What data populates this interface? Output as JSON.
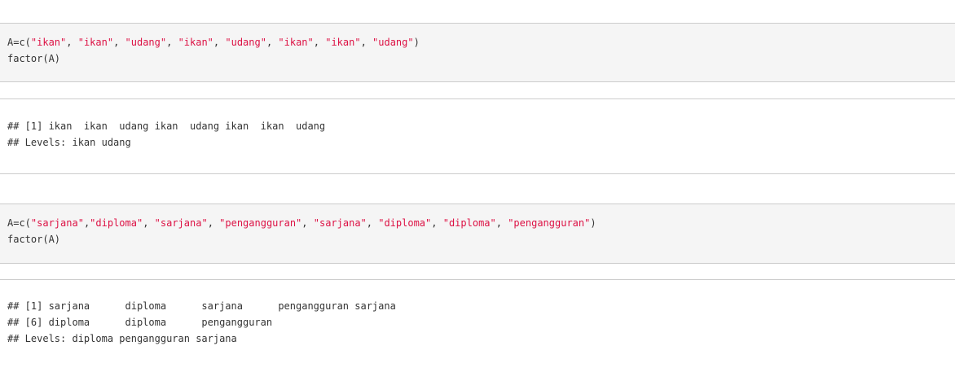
{
  "chunks": [
    {
      "type": "code",
      "lines": [
        [
          {
            "t": "A=c(",
            "k": "plain"
          },
          {
            "t": "\"ikan\"",
            "k": "str"
          },
          {
            "t": ", ",
            "k": "plain"
          },
          {
            "t": "\"ikan\"",
            "k": "str"
          },
          {
            "t": ", ",
            "k": "plain"
          },
          {
            "t": "\"udang\"",
            "k": "str"
          },
          {
            "t": ", ",
            "k": "plain"
          },
          {
            "t": "\"ikan\"",
            "k": "str"
          },
          {
            "t": ", ",
            "k": "plain"
          },
          {
            "t": "\"udang\"",
            "k": "str"
          },
          {
            "t": ", ",
            "k": "plain"
          },
          {
            "t": "\"ikan\"",
            "k": "str"
          },
          {
            "t": ", ",
            "k": "plain"
          },
          {
            "t": "\"ikan\"",
            "k": "str"
          },
          {
            "t": ", ",
            "k": "plain"
          },
          {
            "t": "\"udang\"",
            "k": "str"
          },
          {
            "t": ")",
            "k": "plain"
          }
        ],
        [
          {
            "t": "factor(A)",
            "k": "plain"
          }
        ]
      ]
    },
    {
      "type": "output",
      "lines": [
        "## [1] ikan  ikan  udang ikan  udang ikan  ikan  udang",
        "## Levels: ikan udang"
      ]
    },
    {
      "type": "code",
      "lines": [
        [
          {
            "t": "A=c(",
            "k": "plain"
          },
          {
            "t": "\"sarjana\"",
            "k": "str"
          },
          {
            "t": ",",
            "k": "plain"
          },
          {
            "t": "\"diploma\"",
            "k": "str"
          },
          {
            "t": ", ",
            "k": "plain"
          },
          {
            "t": "\"sarjana\"",
            "k": "str"
          },
          {
            "t": ", ",
            "k": "plain"
          },
          {
            "t": "\"pengangguran\"",
            "k": "str"
          },
          {
            "t": ", ",
            "k": "plain"
          },
          {
            "t": "\"sarjana\"",
            "k": "str"
          },
          {
            "t": ", ",
            "k": "plain"
          },
          {
            "t": "\"diploma\"",
            "k": "str"
          },
          {
            "t": ", ",
            "k": "plain"
          },
          {
            "t": "\"diploma\"",
            "k": "str"
          },
          {
            "t": ", ",
            "k": "plain"
          },
          {
            "t": "\"pengangguran\"",
            "k": "str"
          },
          {
            "t": ")",
            "k": "plain"
          }
        ],
        [
          {
            "t": "factor(A)",
            "k": "plain"
          }
        ]
      ]
    },
    {
      "type": "output",
      "lines": [
        "## [1] sarjana      diploma      sarjana      pengangguran sarjana",
        "## [6] diploma      diploma      pengangguran",
        "## Levels: diploma pengangguran sarjana"
      ]
    }
  ],
  "colors": {
    "string": "#dd1144",
    "text": "#333333",
    "code_bg": "#f5f5f5",
    "border": "#cccccc"
  }
}
